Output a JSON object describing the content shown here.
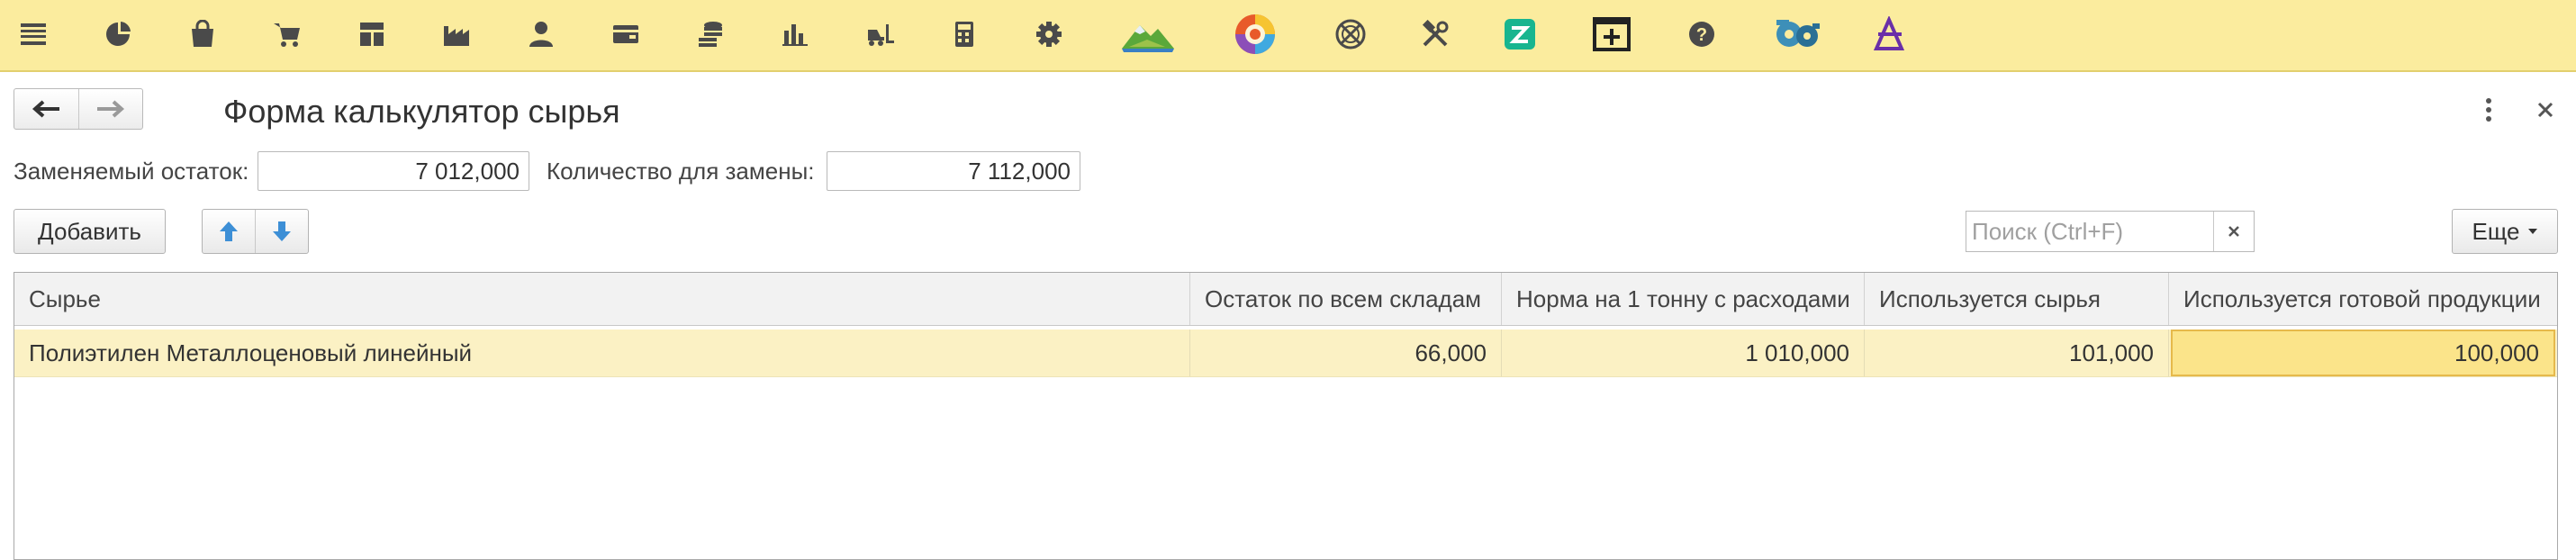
{
  "toolbar": {
    "icons": [
      "menu-icon",
      "pie-chart-icon",
      "shopping-bag-icon",
      "cart-icon",
      "dashboard-icon",
      "factory-icon",
      "person-icon",
      "wallet-icon",
      "coins-icon",
      "bar-chart-icon",
      "forklift-icon",
      "calculator-icon",
      "gear-icon",
      "landscape-icon",
      "color-wheel-icon",
      "clock-crossed-icon",
      "tools-icon",
      "green-logo-icon",
      "add-window-icon",
      "help-icon",
      "gears-icon",
      "purple-logo-icon"
    ]
  },
  "form": {
    "title": "Форма калькулятор сырья",
    "fields": {
      "replaced_label": "Заменяемый остаток:",
      "replaced_value": "7 012,000",
      "qty_label": "Количество для замены:",
      "qty_value": "7 112,000"
    },
    "buttons": {
      "add": "Добавить",
      "more": "Еще"
    },
    "search": {
      "placeholder": "Поиск (Ctrl+F)",
      "value": ""
    }
  },
  "table": {
    "columns": [
      "Сырье",
      "Остаток по всем складам",
      "Норма на 1 тонну с расходами",
      "Используется сырья",
      "Используется готовой продукции"
    ],
    "rows": [
      {
        "material": "Полиэтилен Металлоценовый линейный",
        "stock": "66,000",
        "norm": "1 010,000",
        "used_raw": "101,000",
        "used_finished": "100,000"
      }
    ]
  },
  "colors": {
    "toolbar_bg": "#fbec9e",
    "row_selected_bg": "#fbf1c4",
    "cell_selected_bg": "#fbe48a",
    "arrow_blue": "#3d8fd6"
  }
}
